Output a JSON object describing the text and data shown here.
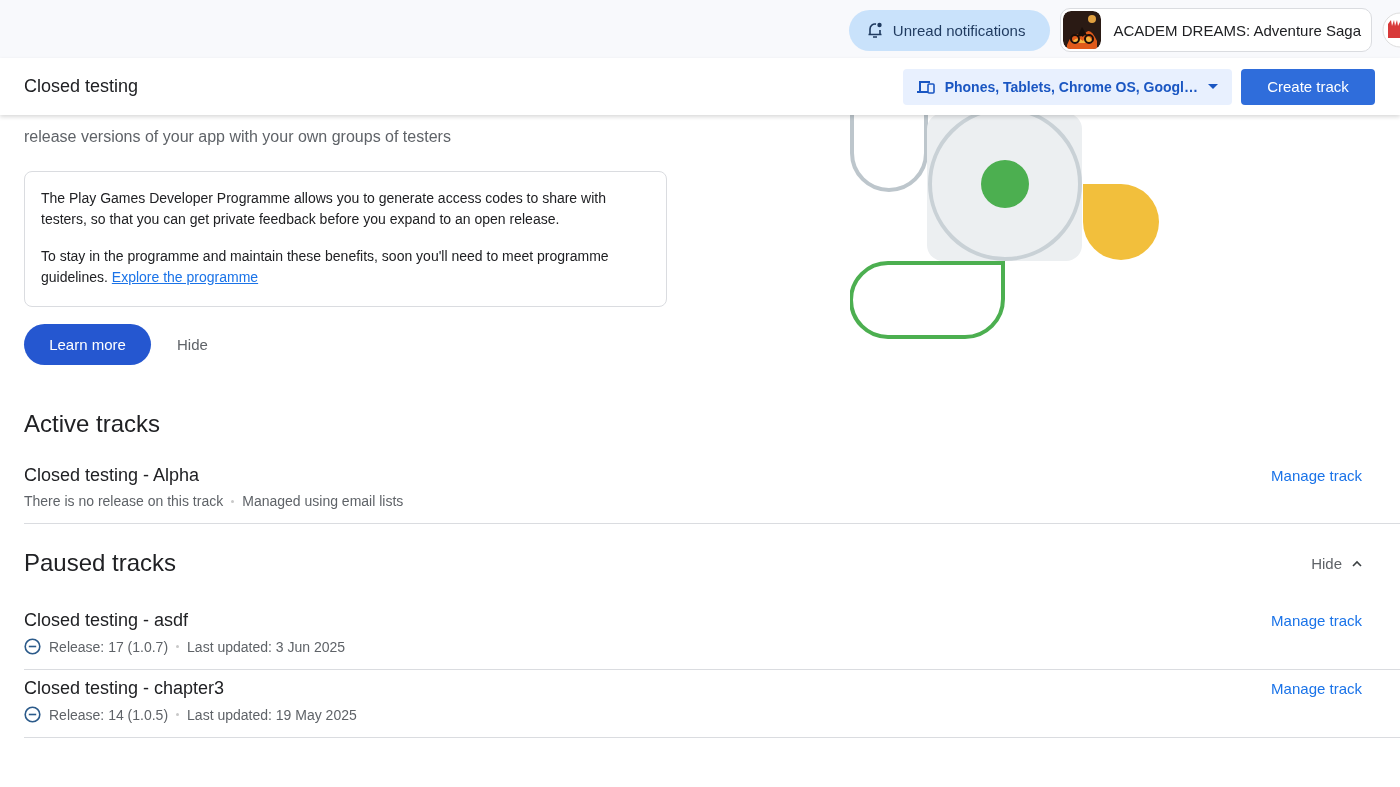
{
  "top_bar": {
    "notifications_button": "Unread notifications",
    "app_selector": {
      "name": "ACADEM DREAMS: Adventure Saga"
    }
  },
  "header": {
    "title": "Closed testing",
    "device_filter": "Phones, Tablets, Chrome OS, Googl…",
    "create_button": "Create track"
  },
  "intro": {
    "description": "release versions of your app with your own groups of testers",
    "notice": {
      "paragraphs": [
        {
          "text": "The Play Games Developer Programme allows you to generate access codes to share with testers, so that you can get private feedback before you expand to an open release."
        },
        {
          "text": "To stay in the programme and maintain these benefits, soon you'll need to meet programme guidelines.",
          "link": "Explore the programme"
        }
      ]
    },
    "buttons": {
      "primary": "Learn more",
      "secondary": "Hide"
    }
  },
  "sections": [
    {
      "title": "Active tracks",
      "tracks": [
        {
          "kind": "active",
          "name": "Closed testing - Alpha",
          "details": [
            "There is no release on this track",
            "Managed using email lists"
          ],
          "action": "Manage track"
        }
      ]
    },
    {
      "title": "Paused tracks",
      "collapse_toggle": {
        "label": "Hide",
        "expanded": true
      },
      "tracks": [
        {
          "kind": "paused",
          "name": "Closed testing - asdf",
          "details": [
            "Release: 17 (1.0.7)",
            "Last updated: 3 Jun 2025"
          ],
          "action": "Manage track"
        },
        {
          "kind": "paused",
          "name": "Closed testing - chapter3",
          "details": [
            "Release: 14 (1.0.5)",
            "Last updated: 19 May 2025"
          ],
          "action": "Manage track"
        }
      ]
    }
  ]
}
